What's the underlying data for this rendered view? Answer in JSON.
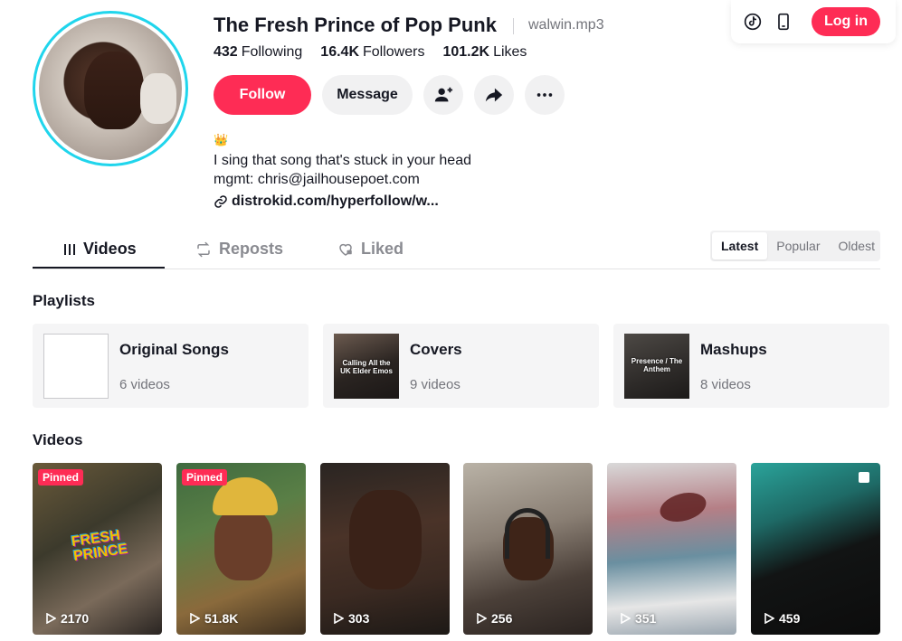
{
  "profile": {
    "name": "The Fresh Prince of Pop Punk",
    "handle": "walwin.mp3",
    "stats": [
      {
        "value": "432",
        "label": "Following"
      },
      {
        "value": "16.4K",
        "label": "Followers"
      },
      {
        "value": "101.2K",
        "label": "Likes"
      }
    ],
    "follow_label": "Follow",
    "message_label": "Message",
    "bio_emoji": "👑",
    "bio_line1": "I sing that song that's stuck in your head",
    "bio_line2": "mgmt: chris@jailhousepoet.com",
    "link": "distrokid.com/hyperfollow/w..."
  },
  "topbar": {
    "login_label": "Log in",
    "icons": [
      "tiktok-icon",
      "mobile-icon"
    ]
  },
  "tabs": [
    {
      "label": "Videos",
      "icon": "grid-icon",
      "active": true
    },
    {
      "label": "Reposts",
      "icon": "repost-icon",
      "active": false
    },
    {
      "label": "Liked",
      "icon": "heart-icon",
      "active": false
    }
  ],
  "sort": [
    {
      "label": "Latest",
      "active": true
    },
    {
      "label": "Popular",
      "active": false
    },
    {
      "label": "Oldest",
      "active": false
    }
  ],
  "playlists_title": "Playlists",
  "playlists": [
    {
      "name": "Original Songs",
      "count": "6 videos",
      "thumb_caption": ""
    },
    {
      "name": "Covers",
      "count": "9 videos",
      "thumb_caption": "Calling All the UK Elder Emos"
    },
    {
      "name": "Mashups",
      "count": "8 videos",
      "thumb_caption": "Presence / The Anthem"
    }
  ],
  "videos_title": "Videos",
  "videos": [
    {
      "views": "2170",
      "pinned": "Pinned"
    },
    {
      "views": "51.8K",
      "pinned": "Pinned"
    },
    {
      "views": "303",
      "pinned": ""
    },
    {
      "views": "256",
      "pinned": ""
    },
    {
      "views": "351",
      "pinned": ""
    },
    {
      "views": "459",
      "pinned": ""
    }
  ],
  "colors": {
    "accent": "#fe2c55",
    "avatar_ring": "#20d5ec",
    "text": "#161823",
    "muted": "#73747b"
  }
}
